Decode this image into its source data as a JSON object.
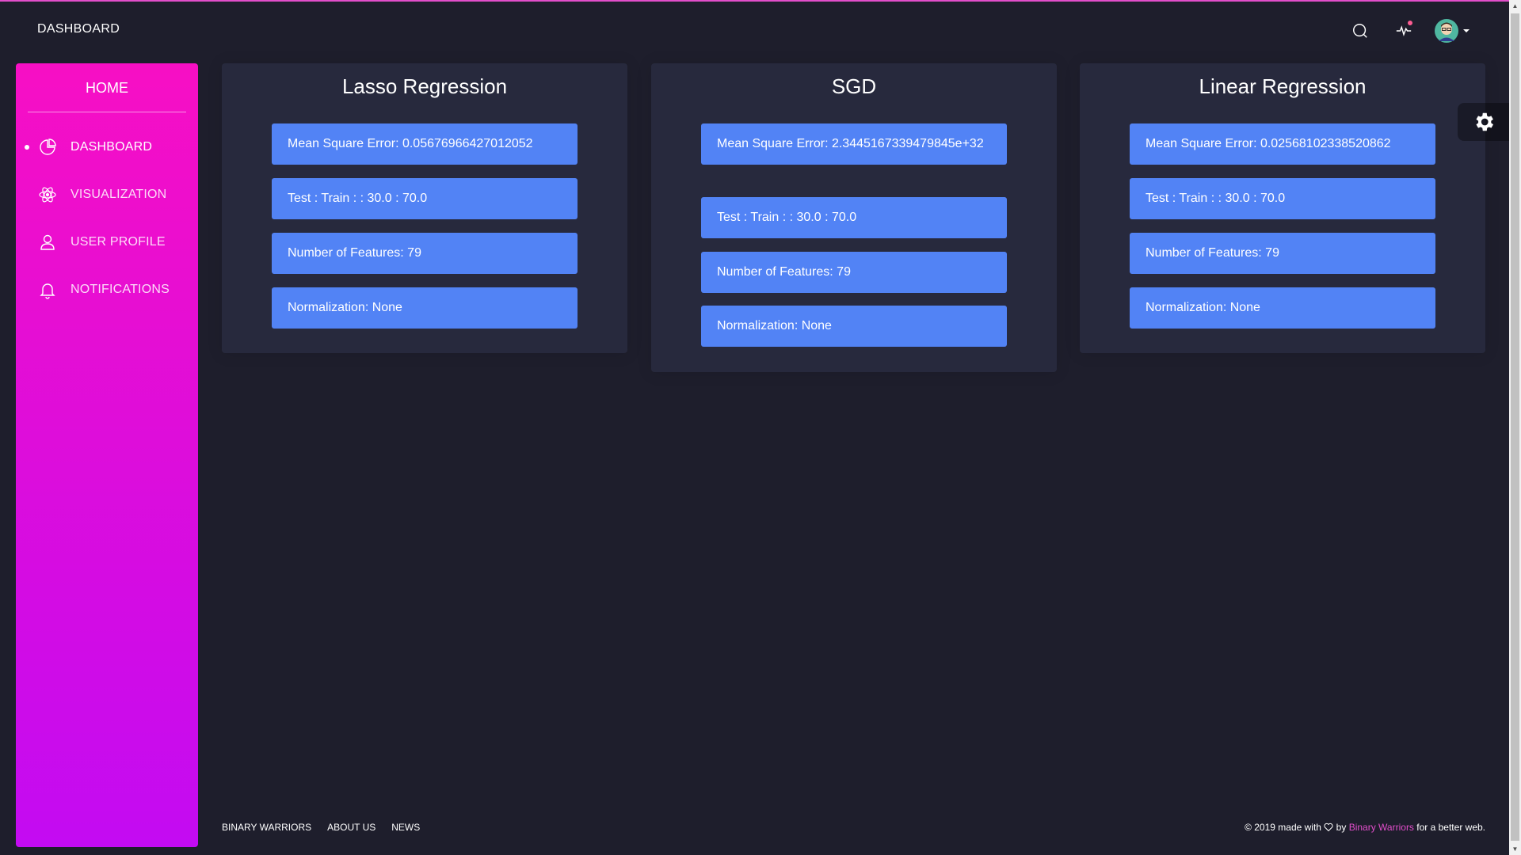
{
  "navbar": {
    "brand": "DASHBOARD",
    "icons": [
      "search-icon",
      "activity-icon",
      "avatar-icon",
      "caret-down-icon"
    ]
  },
  "sidebar": {
    "logo": "HOME",
    "items": [
      {
        "label": "DASHBOARD",
        "icon": "pie-chart-icon",
        "active": true
      },
      {
        "label": "VISUALIZATION",
        "icon": "atom-icon",
        "active": false
      },
      {
        "label": "USER PROFILE",
        "icon": "user-icon",
        "active": false
      },
      {
        "label": "NOTIFICATIONS",
        "icon": "bell-icon",
        "active": false
      }
    ]
  },
  "cards": [
    {
      "title": "Lasso Regression",
      "mse": "Mean Square Error: 0.05676966427012052",
      "split": "Test : Train : : 30.0 : 70.0",
      "features": "Number of Features: 79",
      "normalization": "Normalization: None"
    },
    {
      "title": "SGD",
      "mse": "Mean Square Error: 2.3445167339479845e+32",
      "split": "Test : Train : : 30.0 : 70.0",
      "features": "Number of Features: 79",
      "normalization": "Normalization: None"
    },
    {
      "title": "Linear Regression",
      "mse": "Mean Square Error: 0.02568102338520862",
      "split": "Test : Train : : 30.0 : 70.0",
      "features": "Number of Features: 79",
      "normalization": "Normalization: None"
    }
  ],
  "footer": {
    "links": [
      "BINARY WARRIORS",
      "ABOUT US",
      "NEWS"
    ],
    "copy_prefix": "© 2019 made with",
    "copy_by": "by",
    "copy_brand": "Binary Warriors",
    "copy_suffix": "for a better web."
  },
  "colors": {
    "background": "#1e1e2c",
    "card": "#27293d",
    "accent": "#e14eca",
    "sidebar_top": "#f70fc4",
    "sidebar_bottom": "#c30bf2",
    "pill": "#5283f5"
  }
}
